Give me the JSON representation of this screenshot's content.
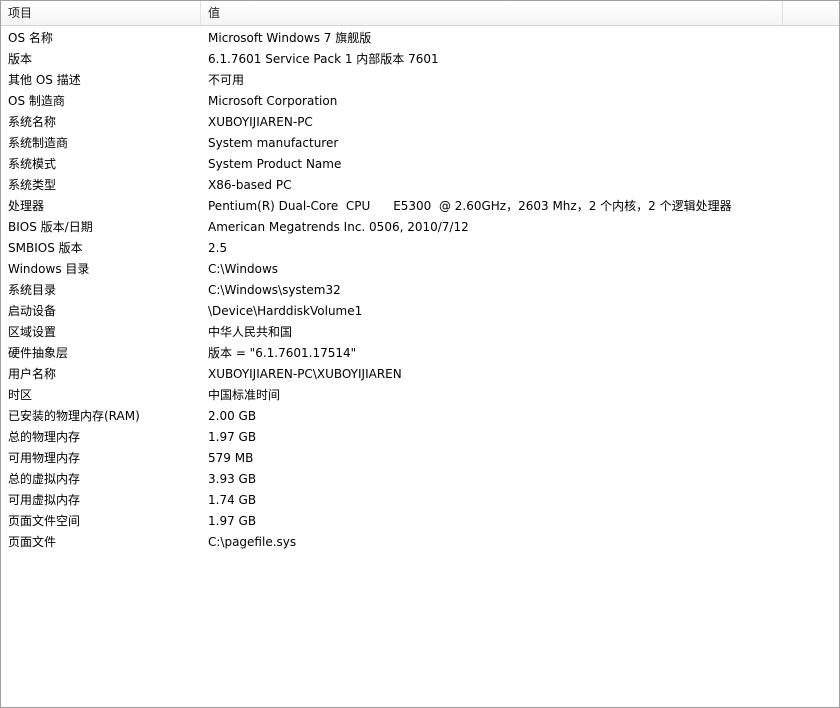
{
  "table": {
    "columns": {
      "item": "项目",
      "value": "值"
    },
    "rows": [
      {
        "item": "OS 名称",
        "value": "Microsoft Windows 7 旗舰版"
      },
      {
        "item": "版本",
        "value": "6.1.7601 Service Pack 1 内部版本 7601"
      },
      {
        "item": "其他 OS 描述",
        "value": "不可用"
      },
      {
        "item": "OS 制造商",
        "value": "Microsoft Corporation"
      },
      {
        "item": "系统名称",
        "value": "XUBOYIJIAREN-PC"
      },
      {
        "item": "系统制造商",
        "value": "System manufacturer"
      },
      {
        "item": "系统模式",
        "value": "System Product Name"
      },
      {
        "item": "系统类型",
        "value": "X86-based PC"
      },
      {
        "item": "处理器",
        "value": "Pentium(R) Dual-Core  CPU      E5300  @ 2.60GHz，2603 Mhz，2 个内核，2 个逻辑处理器"
      },
      {
        "item": "BIOS 版本/日期",
        "value": "American Megatrends Inc. 0506, 2010/7/12"
      },
      {
        "item": "SMBIOS 版本",
        "value": "2.5"
      },
      {
        "item": "Windows 目录",
        "value": "C:\\Windows"
      },
      {
        "item": "系统目录",
        "value": "C:\\Windows\\system32"
      },
      {
        "item": "启动设备",
        "value": "\\Device\\HarddiskVolume1"
      },
      {
        "item": "区域设置",
        "value": "中华人民共和国"
      },
      {
        "item": "硬件抽象层",
        "value": "版本 = \"6.1.7601.17514\""
      },
      {
        "item": "用户名称",
        "value": "XUBOYIJIAREN-PC\\XUBOYIJIAREN"
      },
      {
        "item": "时区",
        "value": "中国标准时间"
      },
      {
        "item": "已安装的物理内存(RAM)",
        "value": "2.00 GB"
      },
      {
        "item": "总的物理内存",
        "value": "1.97 GB"
      },
      {
        "item": "可用物理内存",
        "value": "579 MB"
      },
      {
        "item": "总的虚拟内存",
        "value": "3.93 GB"
      },
      {
        "item": "可用虚拟内存",
        "value": "1.74 GB"
      },
      {
        "item": "页面文件空间",
        "value": "1.97 GB"
      },
      {
        "item": "页面文件",
        "value": "C:\\pagefile.sys"
      }
    ]
  }
}
